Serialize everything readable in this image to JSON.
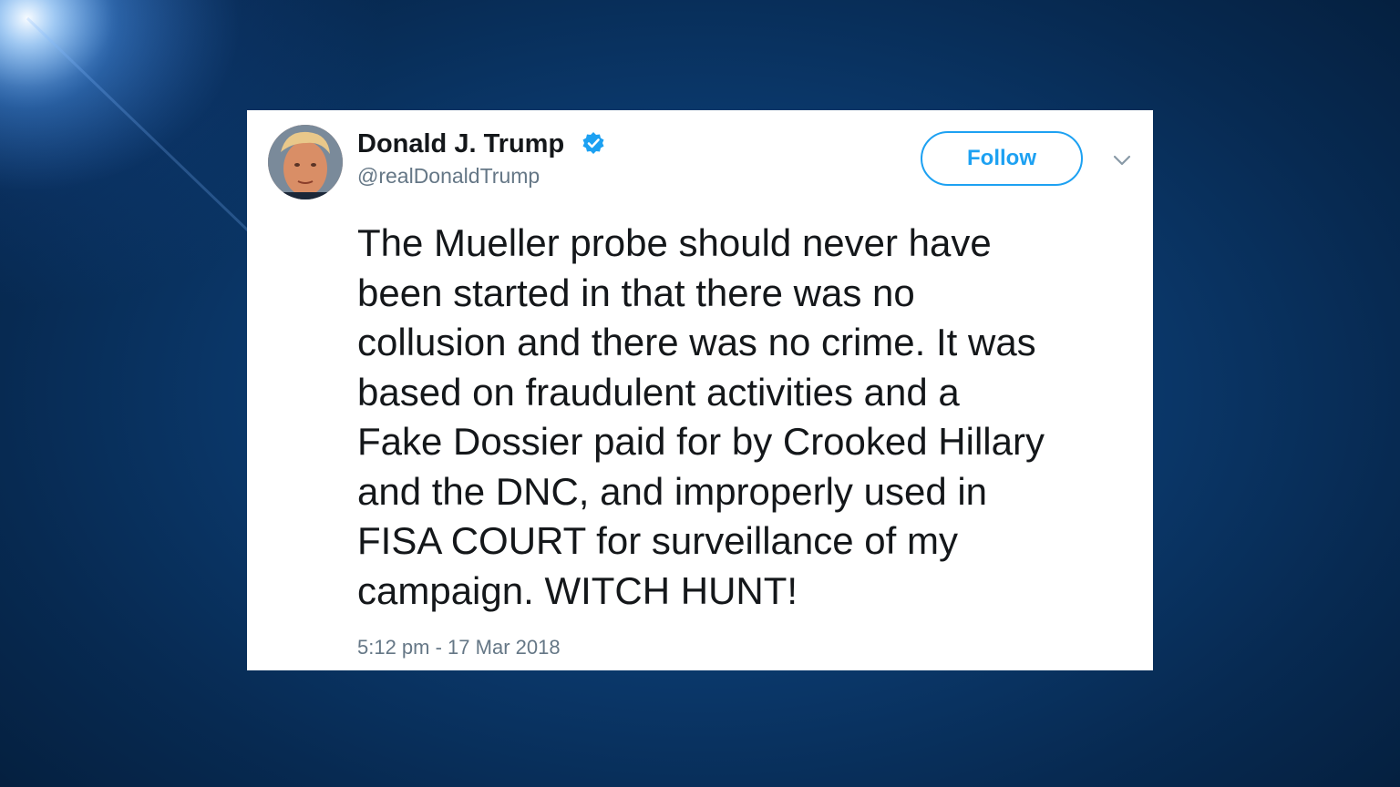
{
  "tweet": {
    "author": {
      "display_name": "Donald J. Trump",
      "handle": "@realDonaldTrump",
      "verified": true,
      "avatar_icon": "profile-photo"
    },
    "follow_label": "Follow",
    "more_icon": "chevron-down-icon",
    "text_lines": [
      "The Mueller probe should never have",
      "been started in that there was no",
      "collusion and there was no crime. It was",
      "based on fraudulent activities and a",
      "Fake Dossier paid for by Crooked Hillary",
      "and the DNC, and improperly used in",
      "FISA COURT for surveillance of my",
      "campaign. WITCH HUNT!"
    ],
    "timestamp": "5:12 pm - 17 Mar 2018"
  },
  "colors": {
    "accent": "#1da1f2",
    "text_primary": "#14171a",
    "text_secondary": "#657786",
    "background_dark": "#072a52",
    "background_mid": "#0f4a86",
    "card": "#ffffff"
  }
}
